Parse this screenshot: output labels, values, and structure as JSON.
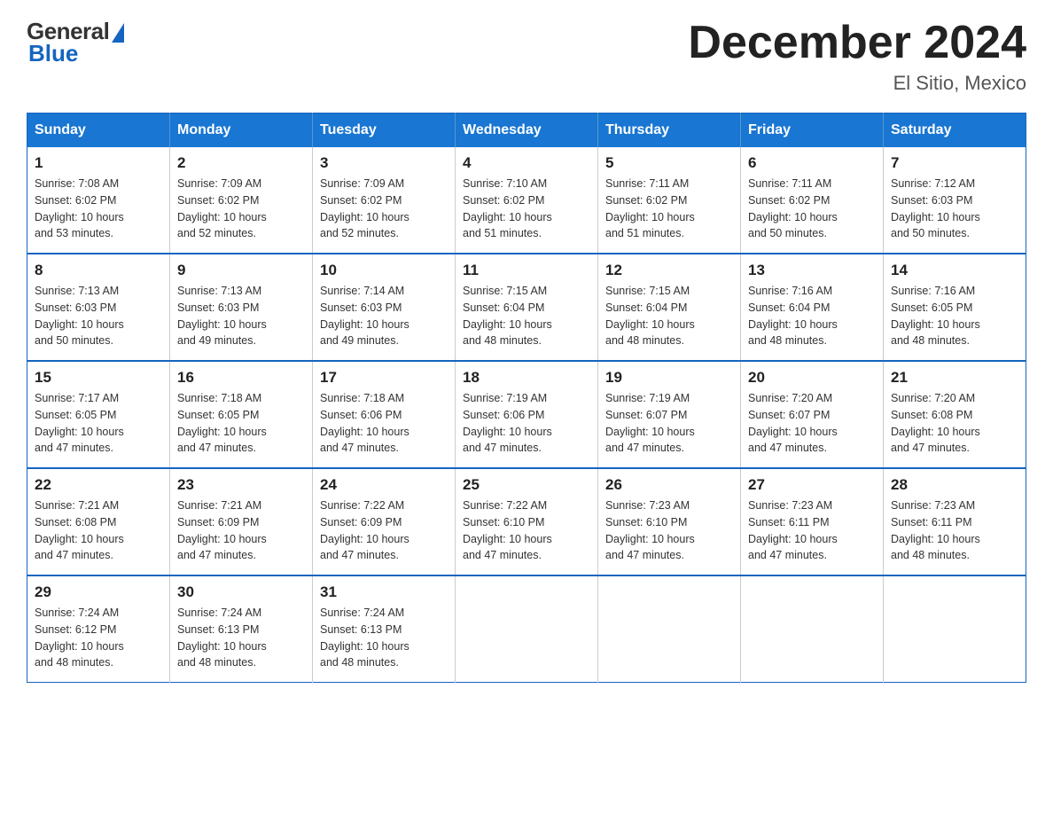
{
  "logo": {
    "general": "General",
    "blue": "Blue"
  },
  "header": {
    "month_title": "December 2024",
    "location": "El Sitio, Mexico"
  },
  "days_of_week": [
    "Sunday",
    "Monday",
    "Tuesday",
    "Wednesday",
    "Thursday",
    "Friday",
    "Saturday"
  ],
  "weeks": [
    [
      {
        "day": "1",
        "sunrise": "7:08 AM",
        "sunset": "6:02 PM",
        "daylight": "10 hours and 53 minutes."
      },
      {
        "day": "2",
        "sunrise": "7:09 AM",
        "sunset": "6:02 PM",
        "daylight": "10 hours and 52 minutes."
      },
      {
        "day": "3",
        "sunrise": "7:09 AM",
        "sunset": "6:02 PM",
        "daylight": "10 hours and 52 minutes."
      },
      {
        "day": "4",
        "sunrise": "7:10 AM",
        "sunset": "6:02 PM",
        "daylight": "10 hours and 51 minutes."
      },
      {
        "day": "5",
        "sunrise": "7:11 AM",
        "sunset": "6:02 PM",
        "daylight": "10 hours and 51 minutes."
      },
      {
        "day": "6",
        "sunrise": "7:11 AM",
        "sunset": "6:02 PM",
        "daylight": "10 hours and 50 minutes."
      },
      {
        "day": "7",
        "sunrise": "7:12 AM",
        "sunset": "6:03 PM",
        "daylight": "10 hours and 50 minutes."
      }
    ],
    [
      {
        "day": "8",
        "sunrise": "7:13 AM",
        "sunset": "6:03 PM",
        "daylight": "10 hours and 50 minutes."
      },
      {
        "day": "9",
        "sunrise": "7:13 AM",
        "sunset": "6:03 PM",
        "daylight": "10 hours and 49 minutes."
      },
      {
        "day": "10",
        "sunrise": "7:14 AM",
        "sunset": "6:03 PM",
        "daylight": "10 hours and 49 minutes."
      },
      {
        "day": "11",
        "sunrise": "7:15 AM",
        "sunset": "6:04 PM",
        "daylight": "10 hours and 48 minutes."
      },
      {
        "day": "12",
        "sunrise": "7:15 AM",
        "sunset": "6:04 PM",
        "daylight": "10 hours and 48 minutes."
      },
      {
        "day": "13",
        "sunrise": "7:16 AM",
        "sunset": "6:04 PM",
        "daylight": "10 hours and 48 minutes."
      },
      {
        "day": "14",
        "sunrise": "7:16 AM",
        "sunset": "6:05 PM",
        "daylight": "10 hours and 48 minutes."
      }
    ],
    [
      {
        "day": "15",
        "sunrise": "7:17 AM",
        "sunset": "6:05 PM",
        "daylight": "10 hours and 47 minutes."
      },
      {
        "day": "16",
        "sunrise": "7:18 AM",
        "sunset": "6:05 PM",
        "daylight": "10 hours and 47 minutes."
      },
      {
        "day": "17",
        "sunrise": "7:18 AM",
        "sunset": "6:06 PM",
        "daylight": "10 hours and 47 minutes."
      },
      {
        "day": "18",
        "sunrise": "7:19 AM",
        "sunset": "6:06 PM",
        "daylight": "10 hours and 47 minutes."
      },
      {
        "day": "19",
        "sunrise": "7:19 AM",
        "sunset": "6:07 PM",
        "daylight": "10 hours and 47 minutes."
      },
      {
        "day": "20",
        "sunrise": "7:20 AM",
        "sunset": "6:07 PM",
        "daylight": "10 hours and 47 minutes."
      },
      {
        "day": "21",
        "sunrise": "7:20 AM",
        "sunset": "6:08 PM",
        "daylight": "10 hours and 47 minutes."
      }
    ],
    [
      {
        "day": "22",
        "sunrise": "7:21 AM",
        "sunset": "6:08 PM",
        "daylight": "10 hours and 47 minutes."
      },
      {
        "day": "23",
        "sunrise": "7:21 AM",
        "sunset": "6:09 PM",
        "daylight": "10 hours and 47 minutes."
      },
      {
        "day": "24",
        "sunrise": "7:22 AM",
        "sunset": "6:09 PM",
        "daylight": "10 hours and 47 minutes."
      },
      {
        "day": "25",
        "sunrise": "7:22 AM",
        "sunset": "6:10 PM",
        "daylight": "10 hours and 47 minutes."
      },
      {
        "day": "26",
        "sunrise": "7:23 AM",
        "sunset": "6:10 PM",
        "daylight": "10 hours and 47 minutes."
      },
      {
        "day": "27",
        "sunrise": "7:23 AM",
        "sunset": "6:11 PM",
        "daylight": "10 hours and 47 minutes."
      },
      {
        "day": "28",
        "sunrise": "7:23 AM",
        "sunset": "6:11 PM",
        "daylight": "10 hours and 48 minutes."
      }
    ],
    [
      {
        "day": "29",
        "sunrise": "7:24 AM",
        "sunset": "6:12 PM",
        "daylight": "10 hours and 48 minutes."
      },
      {
        "day": "30",
        "sunrise": "7:24 AM",
        "sunset": "6:13 PM",
        "daylight": "10 hours and 48 minutes."
      },
      {
        "day": "31",
        "sunrise": "7:24 AM",
        "sunset": "6:13 PM",
        "daylight": "10 hours and 48 minutes."
      },
      null,
      null,
      null,
      null
    ]
  ],
  "labels": {
    "sunrise": "Sunrise:",
    "sunset": "Sunset:",
    "daylight": "Daylight:"
  }
}
